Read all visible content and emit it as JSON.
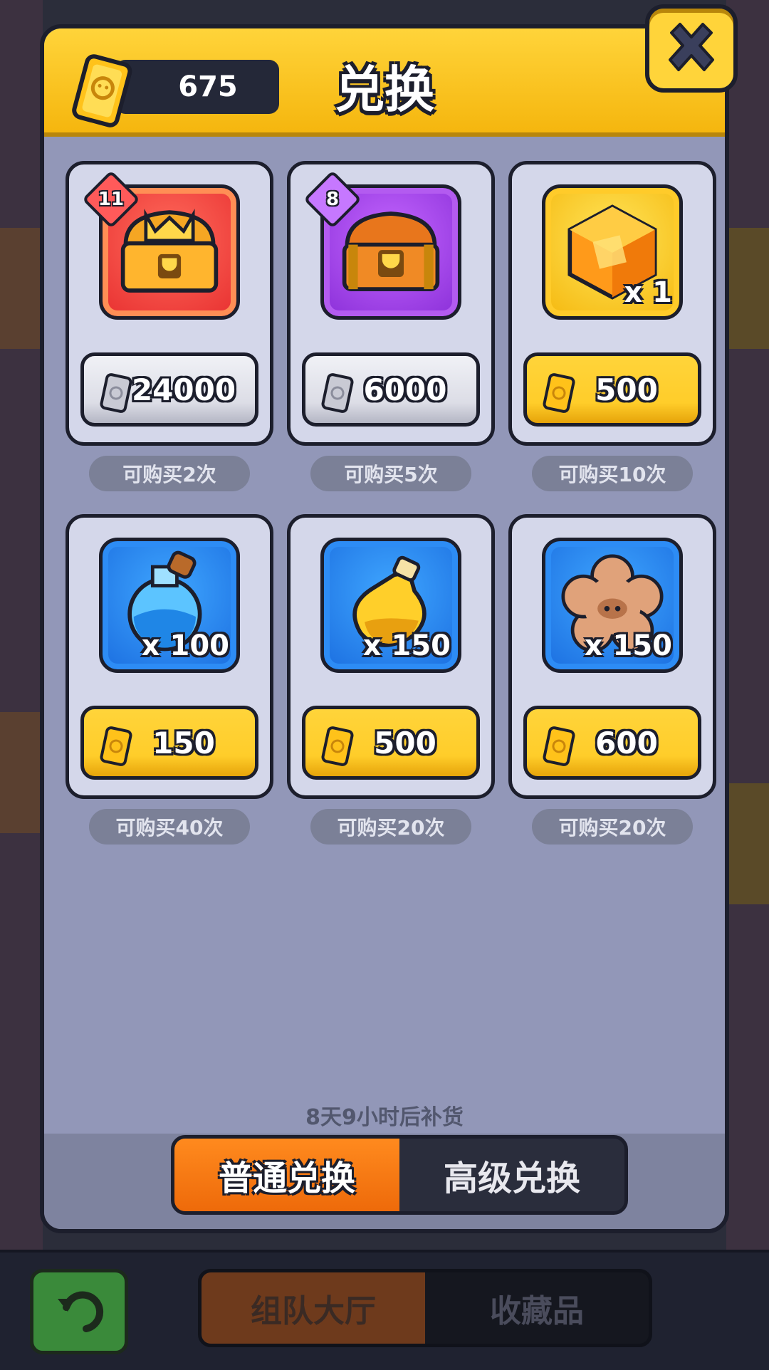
{
  "header": {
    "title": "兑换",
    "currency_amount": "675",
    "currency_icon": "gold-ticket-icon",
    "close_icon": "close-x-icon"
  },
  "items": [
    {
      "name": "red-trophy-chest",
      "icon": "trophy-chest-icon",
      "level": "11",
      "qty": "",
      "price": "24000",
      "price_currency": "silver-ticket-icon",
      "limit": "可购买2次",
      "frame_color": "#e83030"
    },
    {
      "name": "purple-trophy-chest",
      "icon": "trophy-chest-icon",
      "level": "8",
      "qty": "",
      "price": "6000",
      "price_currency": "silver-ticket-icon",
      "limit": "可购买5次",
      "frame_color": "#8a2fd8"
    },
    {
      "name": "gold-gem",
      "icon": "hex-gem-icon",
      "level": "",
      "qty": "x 1",
      "price": "500",
      "price_currency": "gold-ticket-icon",
      "limit": "可购买10次",
      "frame_color": "#f5b80e"
    },
    {
      "name": "blue-potion",
      "icon": "blue-potion-icon",
      "level": "",
      "qty": "x 100",
      "price": "150",
      "price_currency": "gold-ticket-icon",
      "limit": "可购买40次",
      "frame_color": "#1b6ee0"
    },
    {
      "name": "gold-potion",
      "icon": "gold-potion-icon",
      "level": "",
      "qty": "x 150",
      "price": "500",
      "price_currency": "gold-ticket-icon",
      "limit": "可购买20次",
      "frame_color": "#1b6ee0"
    },
    {
      "name": "flower-cookie",
      "icon": "flower-cookie-icon",
      "level": "",
      "qty": "x 150",
      "price": "600",
      "price_currency": "gold-ticket-icon",
      "limit": "可购买20次",
      "frame_color": "#1b6ee0"
    }
  ],
  "restock_text": "8天9小时后补货",
  "tabs": [
    {
      "label": "普通兑换",
      "active": true
    },
    {
      "label": "高级兑换",
      "active": false
    }
  ],
  "bottom_nav": {
    "back_icon": "back-arrow-icon",
    "tabs": [
      {
        "label": "组队大厅",
        "active": true
      },
      {
        "label": "收藏品",
        "active": false
      }
    ]
  },
  "colors": {
    "header_yellow": "#ffd43a",
    "active_tab_orange": "#ff8a1e",
    "panel_bg": "#9297b8",
    "card_bg": "#d4d7ea"
  }
}
